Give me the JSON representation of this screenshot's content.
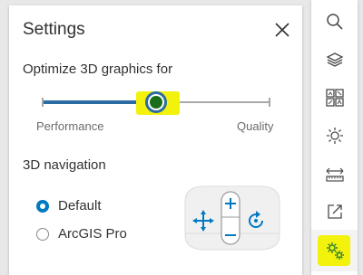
{
  "settings": {
    "title": "Settings",
    "graphics_label": "Optimize 3D graphics for",
    "slider": {
      "value": 0.5,
      "min_label": "Performance",
      "max_label": "Quality"
    },
    "navigation_label": "3D navigation",
    "options": [
      {
        "label": "Default",
        "selected": true
      },
      {
        "label": "ArcGIS Pro",
        "selected": false
      }
    ]
  },
  "toolbar": {
    "tools": [
      {
        "icon": "search-icon"
      },
      {
        "icon": "layers-icon"
      },
      {
        "icon": "basemap-gallery-icon"
      },
      {
        "icon": "daylight-icon"
      },
      {
        "icon": "measure-icon"
      },
      {
        "icon": "share-icon"
      },
      {
        "icon": "settings-gears-icon",
        "active": true
      }
    ]
  },
  "colors": {
    "accent": "#2b6ca3",
    "radio": "#0079c1",
    "highlight": "#f2f20c",
    "thumb_center": "#1a6e1a",
    "icon": "#4a4a4a",
    "mouse_icons": "#0079c1"
  }
}
